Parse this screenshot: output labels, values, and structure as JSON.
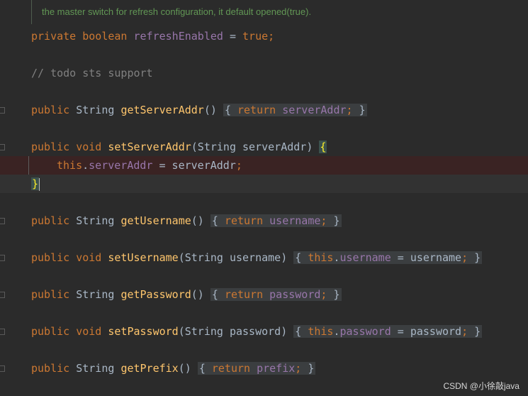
{
  "editor": {
    "doc_comment": "the master switch for refresh configuration, it default opened(true).",
    "field": {
      "modifier": "private",
      "type": "boolean",
      "name": "refreshEnabled",
      "eq": " = ",
      "value": "true",
      "end": ";"
    },
    "todo": "// todo sts support",
    "get_server": {
      "mod": "public",
      "type": "String",
      "name": "getServerAddr",
      "parens": "()",
      "body_kw": "return",
      "body_field": "serverAddr",
      "end": ";"
    },
    "set_server": {
      "mod": "public",
      "type": "void",
      "name": "setServerAddr",
      "param": "(String serverAddr)",
      "open": "{"
    },
    "set_server_body": {
      "this": "this",
      "dot": ".",
      "field": "serverAddr",
      "rest": " = serverAddr",
      "end": ";"
    },
    "close_brace": "}",
    "get_user": {
      "mod": "public",
      "type": "String",
      "name": "getUsername",
      "parens": "()",
      "body_kw": "return",
      "body_field": "username",
      "end": ";"
    },
    "set_user": {
      "mod": "public",
      "type": "void",
      "name": "setUsername",
      "param": "(String username)",
      "this": "this",
      "field": "username",
      "rest": " = username",
      "end": ";"
    },
    "get_pass": {
      "mod": "public",
      "type": "String",
      "name": "getPassword",
      "parens": "()",
      "body_kw": "return",
      "body_field": "password",
      "end": ";"
    },
    "set_pass": {
      "mod": "public",
      "type": "void",
      "name": "setPassword",
      "param": "(String password)",
      "this": "this",
      "field": "password",
      "rest": " = password",
      "end": ";"
    },
    "get_prefix": {
      "mod": "public",
      "type": "String",
      "name": "getPrefix",
      "parens": "()",
      "body_kw": "return",
      "body_field": "prefix",
      "end": ";"
    },
    "fold_open": "{",
    "fold_close": "}"
  },
  "watermark": "CSDN @小徐敲java",
  "colors": {
    "keyword": "#cc7832",
    "field": "#9876aa",
    "method": "#ffc66d",
    "comment": "#808080",
    "doc": "#629755",
    "background": "#2b2b2b"
  }
}
